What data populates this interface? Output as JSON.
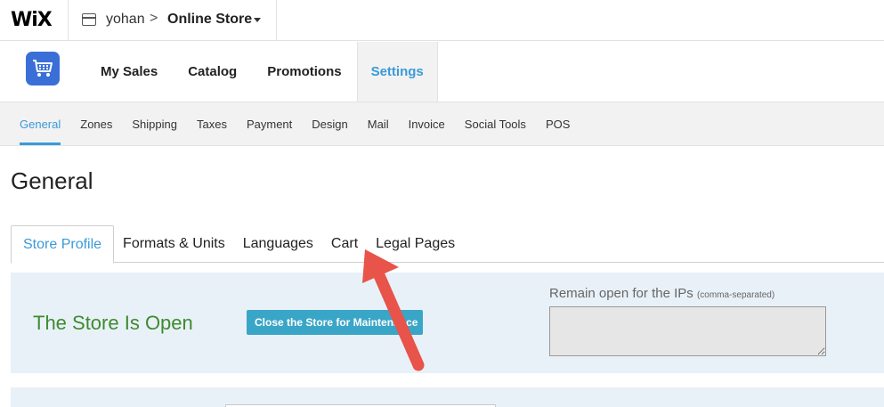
{
  "topbar": {
    "logo": "WiX",
    "user": "yohan",
    "crumb_separator": ">",
    "site_name": "Online Store"
  },
  "main_nav": [
    {
      "label": "My Sales",
      "active": false
    },
    {
      "label": "Catalog",
      "active": false
    },
    {
      "label": "Promotions",
      "active": false
    },
    {
      "label": "Settings",
      "active": true
    }
  ],
  "sub_nav": [
    {
      "label": "General",
      "active": true
    },
    {
      "label": "Zones"
    },
    {
      "label": "Shipping"
    },
    {
      "label": "Taxes"
    },
    {
      "label": "Payment"
    },
    {
      "label": "Design"
    },
    {
      "label": "Mail"
    },
    {
      "label": "Invoice"
    },
    {
      "label": "Social Tools"
    },
    {
      "label": "POS"
    }
  ],
  "page": {
    "title": "General"
  },
  "section_tabs": [
    {
      "label": "Store Profile",
      "active": true
    },
    {
      "label": "Formats & Units"
    },
    {
      "label": "Languages"
    },
    {
      "label": "Cart"
    },
    {
      "label": "Legal Pages"
    }
  ],
  "store_status": {
    "status_text": "The Store Is Open",
    "close_button_label": "Close the Store for Maintenance",
    "ips_label": "Remain open for the IPs",
    "ips_hint": "(comma-separated)",
    "ips_value": ""
  },
  "colors": {
    "accent": "#3a9ad9",
    "status_open": "#3e8a2f",
    "button": "#3aa6c7",
    "panel": "#e9f1f8",
    "annotation_arrow": "#e8534a"
  }
}
